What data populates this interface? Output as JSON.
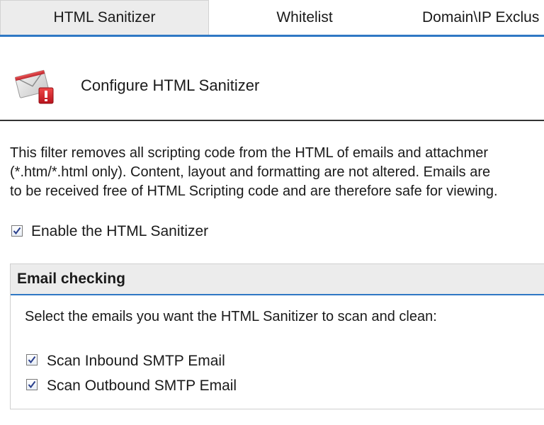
{
  "tabs": [
    {
      "label": "HTML Sanitizer",
      "active": true
    },
    {
      "label": "Whitelist",
      "active": false
    },
    {
      "label": "Domain\\IP Exclus",
      "active": false
    }
  ],
  "header": {
    "title": "Configure HTML Sanitizer",
    "icon": "envelope-alert-icon"
  },
  "description": {
    "lines": [
      "This filter removes all scripting code from the HTML of emails and attachmer",
      "(*.htm/*.html only). Content, layout and formatting are not altered. Emails are",
      "to be received free of HTML Scripting code and are therefore safe for viewing."
    ]
  },
  "enable": {
    "label": "Enable the HTML Sanitizer",
    "checked": true
  },
  "email_checking": {
    "title": "Email checking",
    "intro": "Select the emails you want the HTML Sanitizer to scan and clean:",
    "options": [
      {
        "label": "Scan Inbound SMTP Email",
        "checked": true
      },
      {
        "label": "Scan Outbound SMTP Email",
        "checked": true
      }
    ]
  },
  "colors": {
    "accent": "#2f78c4",
    "tab_active_bg": "#ececec",
    "icon_red": "#d8202a"
  }
}
